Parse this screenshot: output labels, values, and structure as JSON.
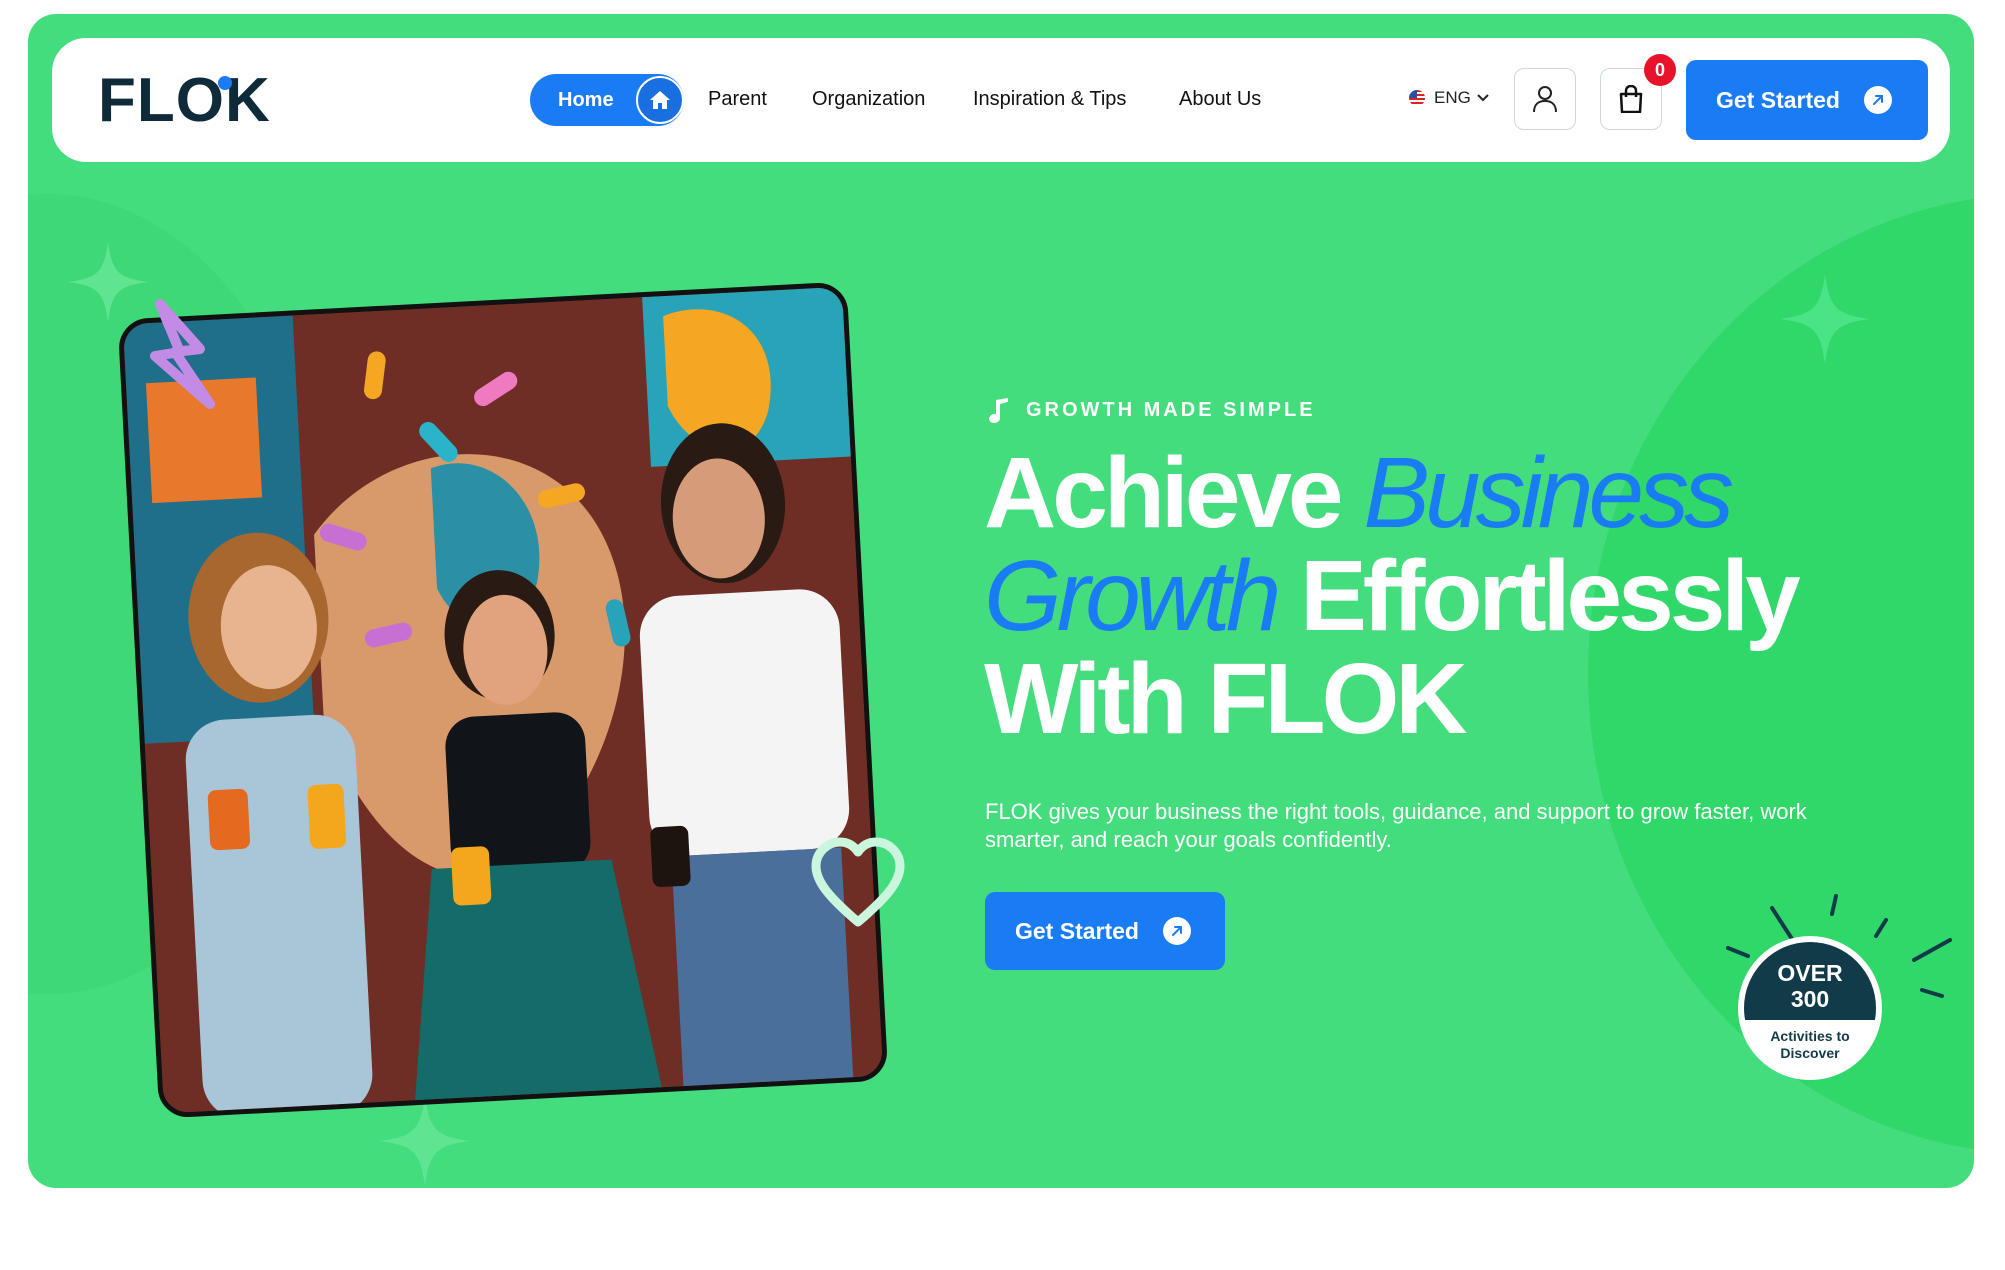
{
  "brand": {
    "logo_text": "FLOK",
    "accent_color": "#1a7cf5",
    "hero_bg": "#44dd7d"
  },
  "nav": {
    "home": "Home",
    "home_icon": "home-icon",
    "links": [
      "Parent",
      "Organization",
      "Inspiration & Tips",
      "About Us"
    ],
    "language": "ENG",
    "user_icon": "user-icon",
    "cart_icon": "shopping-bag-icon",
    "cart_count": "0",
    "cta": "Get Started"
  },
  "hero": {
    "eyebrow": "GROWTH MADE SIMPLE",
    "headline": {
      "part1": "Achieve ",
      "accent1": "Business",
      "accent2": "Growth",
      "part2": " Effortlessly",
      "part3": "With FLOK"
    },
    "description": "FLOK gives your business the right tools, guidance, and support to grow faster, work smarter, and reach your goals confidently.",
    "cta": "Get Started"
  },
  "badge": {
    "line1": "OVER",
    "line2": "300",
    "line3": "Activities to",
    "line4": "Discover"
  }
}
